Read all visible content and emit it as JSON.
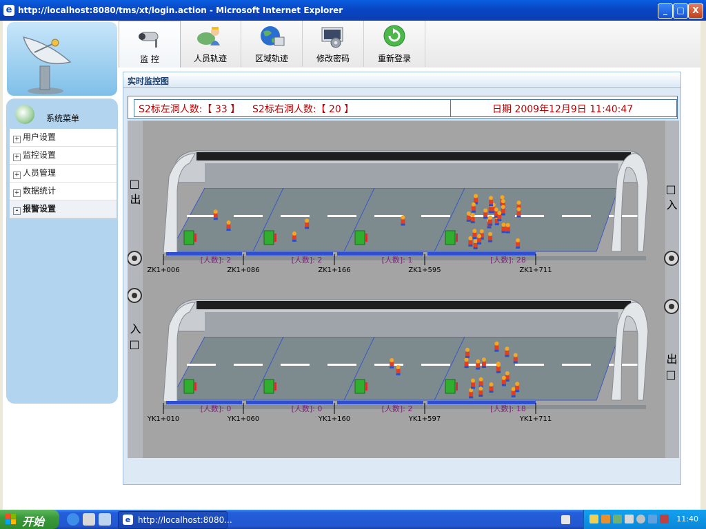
{
  "window": {
    "title": "http://localhost:8080/tms/xt/login.action - Microsoft Internet Explorer",
    "minimize": "_",
    "maximize": "□",
    "close": "X"
  },
  "toolbar": {
    "tabs": [
      {
        "label": "监 控",
        "icon": "camera-icon"
      },
      {
        "label": "人员轨迹",
        "icon": "people-track-icon"
      },
      {
        "label": "区域轨迹",
        "icon": "globe-icon"
      },
      {
        "label": "修改密码",
        "icon": "password-settings-icon"
      },
      {
        "label": "重新登录",
        "icon": "refresh-login-icon"
      }
    ]
  },
  "sidebar": {
    "menu_title": "系统菜单",
    "items": [
      {
        "label": "用户设置",
        "sign": "+"
      },
      {
        "label": "监控设置",
        "sign": "+"
      },
      {
        "label": "人员管理",
        "sign": "+"
      },
      {
        "label": "数据统计",
        "sign": "+"
      },
      {
        "label": "报警设置",
        "sign": "-"
      }
    ]
  },
  "panel": {
    "title": "实时监控图",
    "left_tunnel_label": "S2标左洞人数:【 33 】",
    "right_tunnel_label": "S2标右洞人数:【 20 】",
    "date_text": "日期 2009年12月9日 11:40:47"
  },
  "tunnels": [
    {
      "entry_left": "□ 出",
      "entry_right": "□ 入",
      "stations": [
        "ZK1+006",
        "ZK1+086",
        "ZK1+166",
        "ZK1+595",
        "ZK1+711"
      ],
      "segments": [
        {
          "label": "[人数]: 2",
          "count": 2
        },
        {
          "label": "[人数]: 2",
          "count": 2
        },
        {
          "label": "[人数]: 1",
          "count": 1
        },
        {
          "label": "[人数]: 28",
          "count": 28
        }
      ]
    },
    {
      "entry_left": "入 □",
      "entry_right": "出 □",
      "stations": [
        "YK1+010",
        "YK1+060",
        "YK1+160",
        "YK1+597",
        "YK1+711"
      ],
      "segments": [
        {
          "label": "[人数]: 0",
          "count": 0
        },
        {
          "label": "[人数]: 0",
          "count": 0
        },
        {
          "label": "[人数]: 2",
          "count": 2
        },
        {
          "label": "[人数]: 18",
          "count": 18
        }
      ]
    }
  ],
  "taskbar": {
    "start_label": "开始",
    "task_title": "http://localhost:8080...",
    "clock": "11:40"
  },
  "colors": {
    "title_bar": "#0846c4",
    "panel_border": "#4a79a8",
    "count_text": "#c00000",
    "segment_label": "#7a1f7a",
    "segment_bar": "#2f4fd0"
  }
}
